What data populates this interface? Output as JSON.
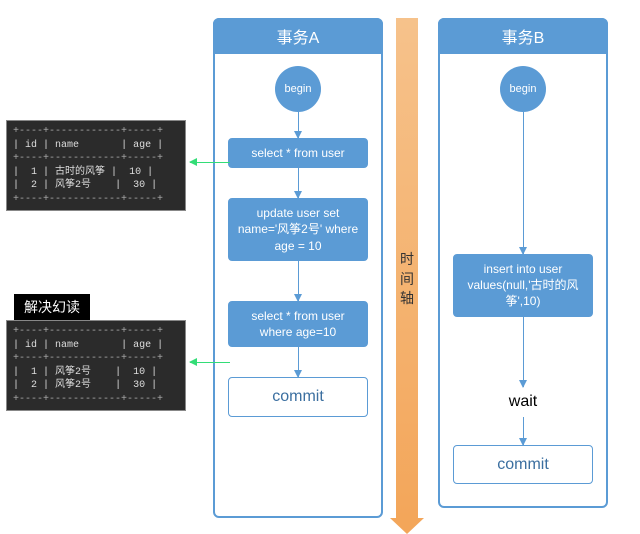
{
  "txA": {
    "title": "事务A",
    "begin": "begin",
    "step1": "select * from user",
    "step2": "update user set name='风筝2号' where age = 10",
    "step3": "select * from user where age=10",
    "commit": "commit"
  },
  "txB": {
    "title": "事务B",
    "begin": "begin",
    "step1": "insert into user values(null,'古时的风筝',10)",
    "wait": "wait",
    "commit": "commit"
  },
  "timeAxis": {
    "label": "时间轴"
  },
  "table1": {
    "header": {
      "id": "id",
      "name": "name",
      "age": "age"
    },
    "rows": [
      {
        "id": "1",
        "name": "古时的风筝",
        "age": "10"
      },
      {
        "id": "2",
        "name": "风筝2号",
        "age": "30"
      }
    ]
  },
  "table2": {
    "title": "解决幻读",
    "header": {
      "id": "id",
      "name": "name",
      "age": "age"
    },
    "rows": [
      {
        "id": "1",
        "name": "风筝2号",
        "age": "10"
      },
      {
        "id": "2",
        "name": "风筝2号",
        "age": "30"
      }
    ]
  }
}
